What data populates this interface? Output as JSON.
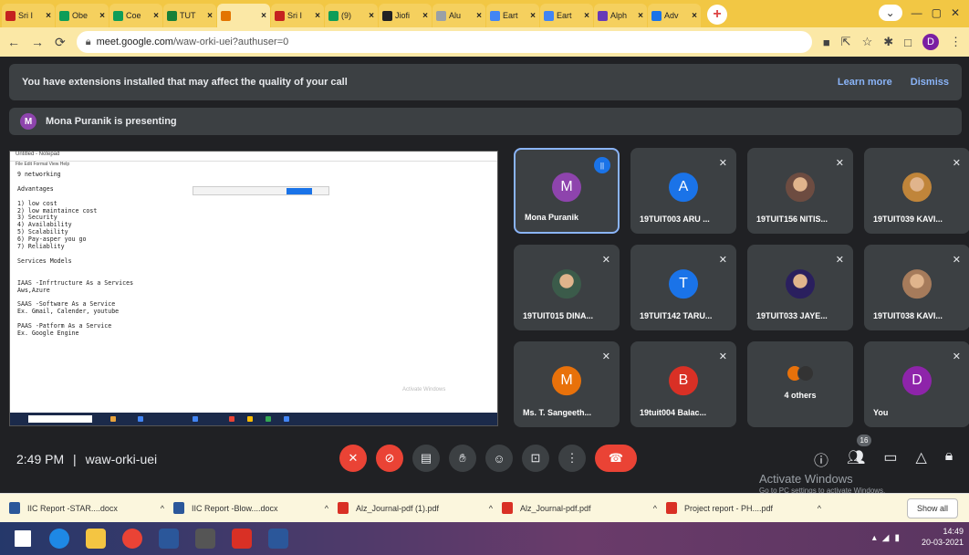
{
  "browser": {
    "tabs": [
      {
        "label": "Sri I",
        "color": "#c5221f",
        "active": false
      },
      {
        "label": "Obe",
        "color": "#0f9d58",
        "active": false
      },
      {
        "label": "Coe",
        "color": "#0f9d58",
        "active": false
      },
      {
        "label": "TUT",
        "color": "#188038",
        "active": false
      },
      {
        "label": "",
        "color": "#e37400",
        "active": true
      },
      {
        "label": "Sri I",
        "color": "#c5221f",
        "active": false
      },
      {
        "label": "(9)",
        "color": "#0f9d58",
        "active": false
      },
      {
        "label": "Jiofi",
        "color": "#202124",
        "active": false
      },
      {
        "label": "Alu",
        "color": "#9aa0a6",
        "active": false
      },
      {
        "label": "Eart",
        "color": "#4285f4",
        "active": false
      },
      {
        "label": "Eart",
        "color": "#4285f4",
        "active": false
      },
      {
        "label": "Alph",
        "color": "#673ab7",
        "active": false
      },
      {
        "label": "Adv",
        "color": "#1a73e8",
        "active": false
      }
    ],
    "url_host": "meet.google.com",
    "url_path": "/waw-orki-uei?authuser=0",
    "profile_letter": "D"
  },
  "meet": {
    "banner_text": "You have extensions installed that may affect the quality of your call",
    "learn_more": "Learn more",
    "dismiss": "Dismiss",
    "presenting_avatar": "M",
    "presenting_text": "Mona Puranik is presenting",
    "shared_lines": "9 networking\n\nAdvantages\n\n1) low cost\n2) low maintaince cost\n3) Security\n4) Availability\n5) Scalability\n6) Pay-asper you go\n7) Reliablity\n\nServices Models\n\n\nIAAS -Infrtructure As a Services\nAws,Azure\n\nSAAS -Software As a Service\nEx. Gmail, Calender, youtube\n\nPAAS -Patform As a Service\nEx. Google Engine",
    "participants": [
      {
        "name": "Mona Puranik",
        "initial": "M",
        "color": "#8e44ad",
        "type": "letter",
        "speaking": true
      },
      {
        "name": "19TUIT003 ARU ...",
        "initial": "A",
        "color": "#1a73e8",
        "type": "letter"
      },
      {
        "name": "19TUIT156 NITIS...",
        "initial": "",
        "color": "#6d4c41",
        "type": "photo"
      },
      {
        "name": "19TUIT039 KAVI...",
        "initial": "",
        "color": "#c0853a",
        "type": "photo"
      },
      {
        "name": "19TUIT015 DINA...",
        "initial": "",
        "color": "#3b5b4a",
        "type": "photo"
      },
      {
        "name": "19TUIT142 TARU...",
        "initial": "T",
        "color": "#1a73e8",
        "type": "letter"
      },
      {
        "name": "19TUIT033 JAYE...",
        "initial": "",
        "color": "#2a1f5e",
        "type": "photo"
      },
      {
        "name": "19TUIT038 KAVI...",
        "initial": "",
        "color": "#a67b5b",
        "type": "photo"
      },
      {
        "name": "Ms. T. Sangeeth...",
        "initial": "M",
        "color": "#e8710a",
        "type": "letter"
      },
      {
        "name": "19tuit004 Balac...",
        "initial": "B",
        "color": "#d93025",
        "type": "letter"
      },
      {
        "name": "4 others",
        "initial": "",
        "color": "#e8710a",
        "type": "others"
      },
      {
        "name": "You",
        "initial": "D",
        "color": "#8e24aa",
        "type": "letter"
      }
    ],
    "time": "2:49 PM",
    "separator": "|",
    "meeting_code": "waw-orki-uei",
    "participant_count": "16",
    "activate_title": "Activate Windows",
    "activate_sub": "Go to PC settings to activate Windows."
  },
  "downloads": [
    {
      "name": "IIC Report -STAR....docx",
      "color": "#2b579a"
    },
    {
      "name": "IIC Report -Blow....docx",
      "color": "#2b579a"
    },
    {
      "name": "Alz_Journal-pdf (1).pdf",
      "color": "#d93025"
    },
    {
      "name": "Alz_Journal-pdf.pdf",
      "color": "#d93025"
    },
    {
      "name": "Project report - PH....pdf",
      "color": "#d93025"
    }
  ],
  "show_all": "Show all",
  "taskbar": {
    "time": "14:49",
    "date": "20-03-2021"
  }
}
